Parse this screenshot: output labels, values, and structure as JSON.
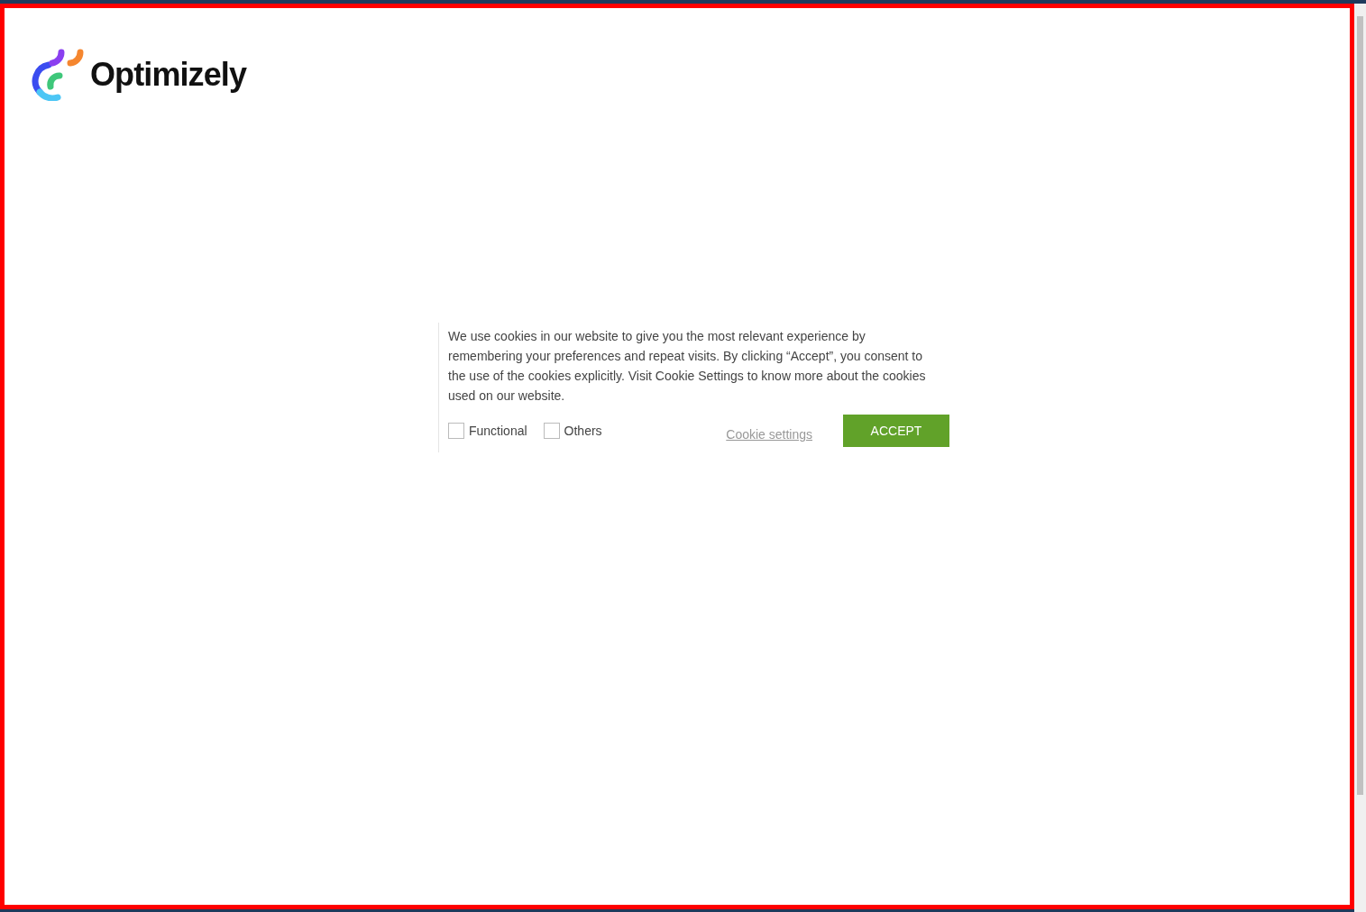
{
  "logo": {
    "text": "Optimizely"
  },
  "cookie_banner": {
    "message": "We use cookies in our website to give you the most relevant experience by remembering your preferences and repeat visits. By clicking “Accept”, you consent to the use of the cookies explicitly. Visit Cookie Settings to know more about the cookies used on our website.",
    "options": [
      {
        "label": "Functional",
        "checked": false
      },
      {
        "label": "Others",
        "checked": false
      }
    ],
    "settings_link": "Cookie settings",
    "accept_button": "ACCEPT"
  }
}
